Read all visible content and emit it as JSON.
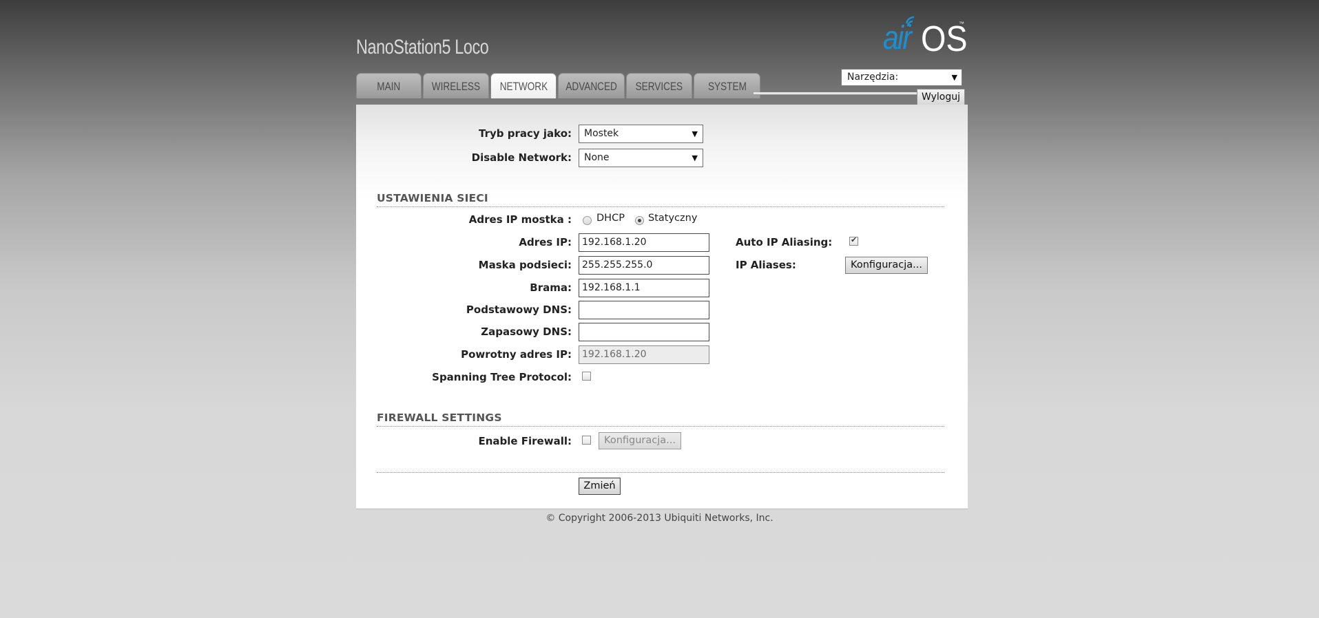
{
  "header": {
    "device_name": "NanoStation5 Loco",
    "logo": {
      "air": "air",
      "os": "OS",
      "tm": "™",
      "color": "#1b8fd1"
    }
  },
  "tabs": [
    {
      "label": "MAIN"
    },
    {
      "label": "WIRELESS"
    },
    {
      "label": "NETWORK",
      "active": true
    },
    {
      "label": "ADVANCED"
    },
    {
      "label": "SERVICES"
    },
    {
      "label": "SYSTEM"
    }
  ],
  "tools": {
    "selected": "Narzędzia:"
  },
  "logout_label": "Wyloguj",
  "form": {
    "mode": {
      "label": "Tryb pracy jako:",
      "value": "Mostek"
    },
    "disable_network": {
      "label": "Disable Network:",
      "value": "None"
    }
  },
  "network": {
    "title": "USTAWIENIA SIECI",
    "ip_mode": {
      "label": "Adres IP mostka :",
      "options": [
        "DHCP",
        "Statyczny"
      ],
      "selected": "Statyczny"
    },
    "ip": {
      "label": "Adres IP:",
      "value": "192.168.1.20"
    },
    "netmask": {
      "label": "Maska podsieci:",
      "value": "255.255.255.0"
    },
    "gateway": {
      "label": "Brama:",
      "value": "192.168.1.1"
    },
    "primary_dns": {
      "label": "Podstawowy DNS:",
      "value": ""
    },
    "secondary_dns": {
      "label": "Zapasowy DNS:",
      "value": ""
    },
    "fallback_ip": {
      "label": "Powrotny adres IP:",
      "value": "192.168.1.20"
    },
    "stp": {
      "label": "Spanning Tree Protocol:",
      "checked": false
    },
    "auto_ip_aliasing": {
      "label": "Auto IP Aliasing:",
      "checked": true
    },
    "ip_aliases": {
      "label": "IP Aliases:",
      "button": "Konfiguracja..."
    }
  },
  "firewall": {
    "title": "FIREWALL SETTINGS",
    "enable": {
      "label": "Enable Firewall:",
      "checked": false
    },
    "button": "Konfiguracja..."
  },
  "submit_label": "Zmień",
  "footer": {
    "copyright": "© Copyright 2006-2013 Ubiquiti Networks, Inc."
  }
}
